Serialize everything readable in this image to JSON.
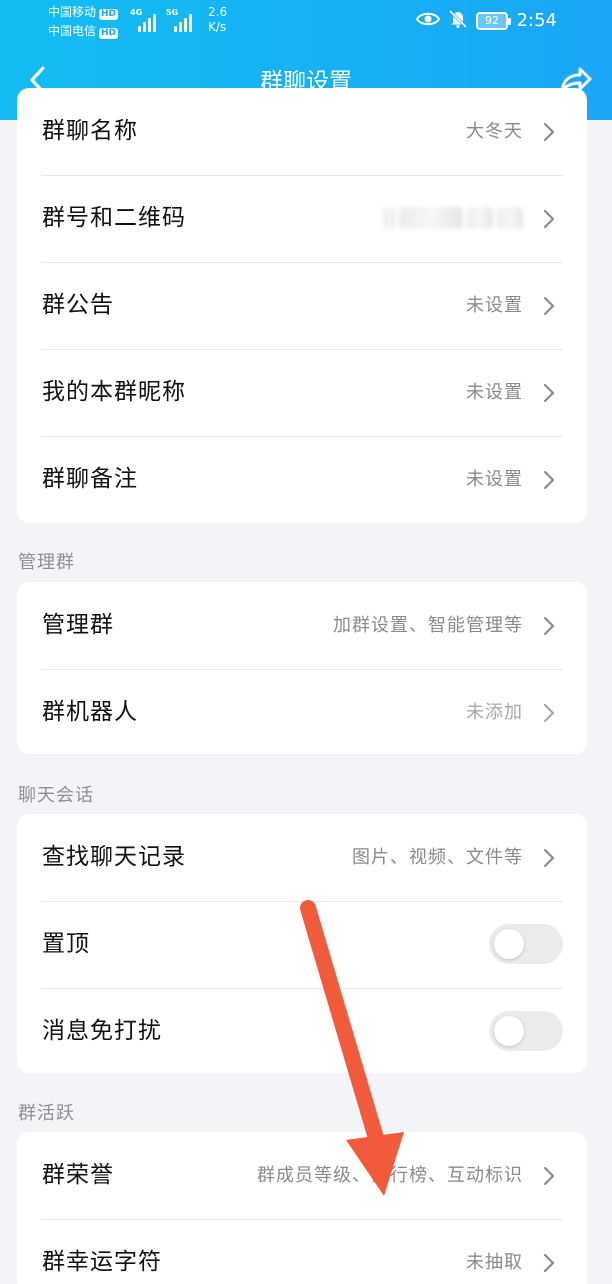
{
  "status_bar": {
    "carrier1": "中国移动",
    "carrier2": "中国电信",
    "hd_label": "HD",
    "net1": "4G",
    "net2": "5G",
    "speed_value": "2.6",
    "speed_unit": "K/s",
    "battery": "92",
    "time": "2:54"
  },
  "header": {
    "title": "群聊设置",
    "back_icon": "chevron-left-icon",
    "share_icon": "share-icon"
  },
  "group_info": [
    {
      "label": "群聊名称",
      "value": "大冬天"
    },
    {
      "label": "群号和二维码",
      "value": ""
    },
    {
      "label": "群公告",
      "value": "未设置"
    },
    {
      "label": "我的本群昵称",
      "value": "未设置"
    },
    {
      "label": "群聊备注",
      "value": "未设置"
    }
  ],
  "manage_section": {
    "title": "管理群",
    "items": [
      {
        "label": "管理群",
        "value": "加群设置、智能管理等"
      },
      {
        "label": "群机器人",
        "value": "未添加"
      }
    ]
  },
  "chat_section": {
    "title": "聊天会话",
    "search": {
      "label": "查找聊天记录",
      "value": "图片、视频、文件等"
    },
    "pin": {
      "label": "置顶",
      "on": false
    },
    "mute": {
      "label": "消息免打扰",
      "on": false
    }
  },
  "activity_section": {
    "title": "群活跃",
    "items": [
      {
        "label": "群荣誉",
        "value": "群成员等级、排行榜、互动标识"
      },
      {
        "label": "群幸运字符",
        "value": "未抽取"
      }
    ]
  },
  "colors": {
    "header": "#1aa6f5",
    "arrow": "#f25a3c",
    "background": "#f3f4f8"
  }
}
